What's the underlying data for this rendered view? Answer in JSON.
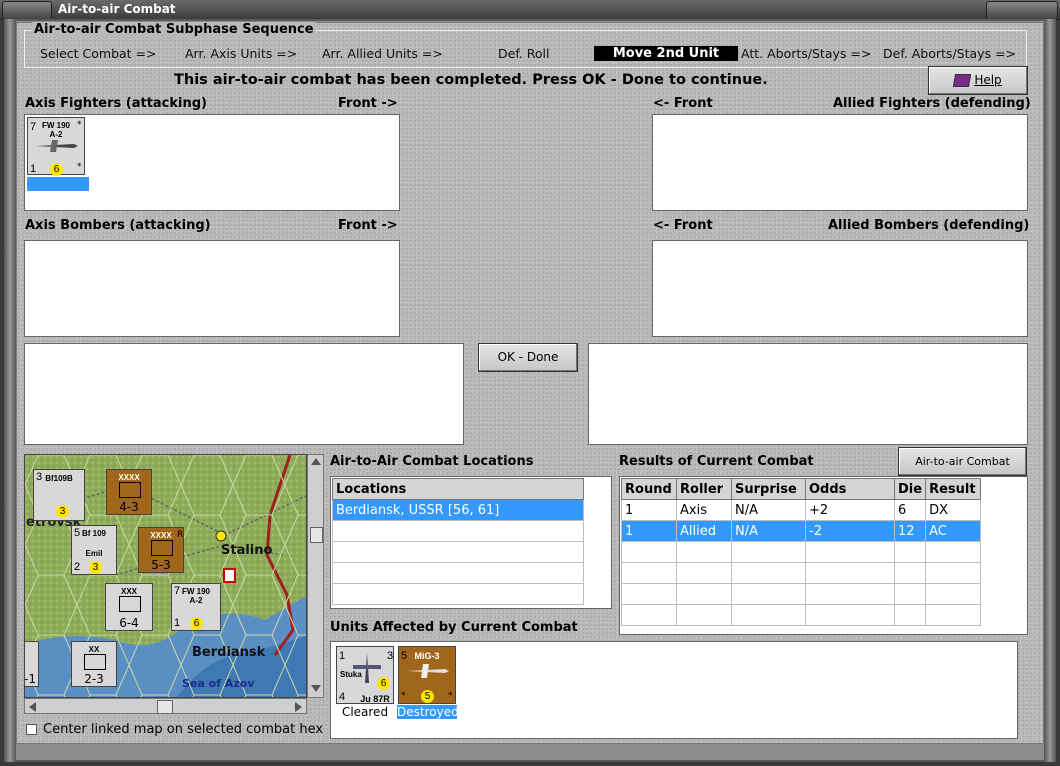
{
  "window": {
    "title": "Air-to-air Combat"
  },
  "sequence": {
    "title": "Air-to-air Combat Subphase Sequence",
    "steps": [
      "Select Combat =>",
      "Arr. Axis Units =>",
      "Arr. Allied Units =>",
      "Def. Roll",
      "Move 2nd Unit",
      "Att. Aborts/Stays =>",
      "Def. Aborts/Stays =>"
    ],
    "active_step": "Move 2nd Unit"
  },
  "status_message": "This air-to-air combat has been completed.  Press OK - Done to continue.",
  "help_button": {
    "label": "Help",
    "icon": "book-icon"
  },
  "axis_fighters": {
    "label": "Axis Fighters (attacking)",
    "front": "Front ->",
    "units": [
      {
        "type": "FW 190",
        "variant": "A-2",
        "attack": "7",
        "defense": "1",
        "range": "6"
      }
    ]
  },
  "allied_fighters": {
    "label": "Allied Fighters (defending)",
    "front": "<- Front"
  },
  "axis_bombers": {
    "label": "Axis Bombers (attacking)",
    "front": "Front ->"
  },
  "allied_bombers": {
    "label": "Allied Bombers (defending)",
    "front": "<- Front"
  },
  "ok_button": {
    "label": "OK - Done"
  },
  "map": {
    "places": [
      "Stalino",
      "Berdiansk",
      "Sea of Azov",
      "etrovsk"
    ],
    "units": [
      {
        "id": "bf109b",
        "name": "Bf109B",
        "a": "3",
        "d": "",
        "r": "3",
        "top_stack": "4"
      },
      {
        "id": "xxxx1",
        "size": "XXXX",
        "value": "4-3",
        "top_stack": "5"
      },
      {
        "id": "bf109e",
        "name": "Bf 109",
        "sub": "Emil",
        "a": "5",
        "d": "2",
        "r": "3",
        "top_stack": "4"
      },
      {
        "id": "xxxx2",
        "size": "XXXX",
        "marker": "R",
        "value": "5-3",
        "top_stack": "3"
      },
      {
        "id": "xxx",
        "size": "XXX",
        "value": "6-4",
        "top_stack": "3"
      },
      {
        "id": "fw190map",
        "name": "FW 190",
        "sub": "A-2",
        "a": "7",
        "d": "1",
        "r": "6",
        "top_stack": "4"
      },
      {
        "id": "xx",
        "size": "XX",
        "value": "2-3",
        "top_stack": "3"
      },
      {
        "id": "edge",
        "value": "-1"
      }
    ]
  },
  "center_map_checkbox": {
    "label": "Center linked map on selected combat hex",
    "checked": false
  },
  "locations": {
    "label": "Air-to-Air Combat Locations",
    "header": "Locations",
    "rows": [
      "Berdiansk, USSR [56, 61]"
    ]
  },
  "results": {
    "label": "Results of Current Combat",
    "chart_button": "Air-to-air Combat Chart",
    "columns": [
      "Round",
      "Roller",
      "Surprise",
      "Odds",
      "Die",
      "Result"
    ],
    "rows": [
      [
        "1",
        "Axis",
        "N/A",
        "+2",
        "6",
        "DX"
      ],
      [
        "1",
        "Allied",
        "N/A",
        "-2",
        "12",
        "AC"
      ]
    ]
  },
  "affected": {
    "label": "Units Affected by Current Combat",
    "units": [
      {
        "name": "Ju 87R",
        "sub": "Stuka",
        "a": "1",
        "b": "3",
        "d": "4",
        "r": "6",
        "status": "Cleared"
      },
      {
        "name": "MiG-3",
        "a": "5",
        "r": "5",
        "status": "Destroyed"
      }
    ]
  },
  "colors": {
    "selection": "#3399ff",
    "soviet_counter": "#a0661c",
    "die_circle": "#ffe600"
  }
}
